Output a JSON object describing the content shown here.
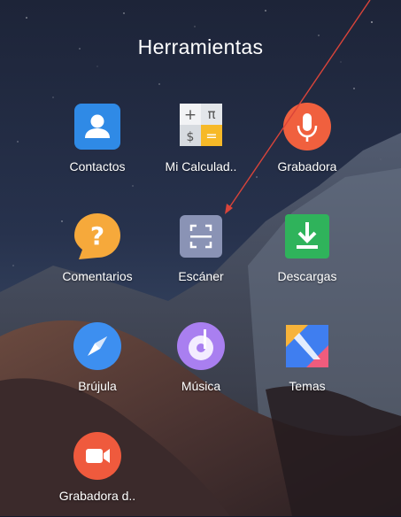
{
  "folder": {
    "title": "Herramientas",
    "apps": [
      {
        "label": "Contactos",
        "icon": "contacts-icon",
        "color": "#2f8ae6"
      },
      {
        "label": "Mi Calculad..",
        "icon": "calculator-icon",
        "color": "#e8ebef"
      },
      {
        "label": "Grabadora",
        "icon": "microphone-icon",
        "color": "#f0603e"
      },
      {
        "label": "Comentarios",
        "icon": "feedback-question-icon",
        "color": "#f6a93b"
      },
      {
        "label": "Escáner",
        "icon": "scanner-icon",
        "color": "#8a93b5"
      },
      {
        "label": "Descargas",
        "icon": "download-icon",
        "color": "#2fb35b"
      },
      {
        "label": "Brújula",
        "icon": "compass-icon",
        "color": "#3d8ff0"
      },
      {
        "label": "Música",
        "icon": "music-icon",
        "color": "#a97ff0"
      },
      {
        "label": "Temas",
        "icon": "themes-icon",
        "color": "#3f7ef0"
      },
      {
        "label": "Grabadora d..",
        "icon": "screen-recorder-icon",
        "color": "#ef5a3d"
      }
    ]
  },
  "annotation": {
    "color": "#d9443a",
    "points_to": "Escáner"
  }
}
